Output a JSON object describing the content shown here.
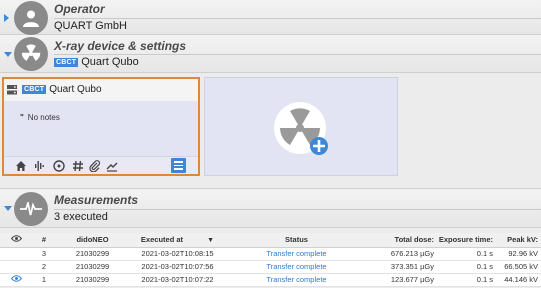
{
  "operator": {
    "title": "Operator",
    "name": "QUART GmbH"
  },
  "xray": {
    "title": "X-ray device & settings",
    "badge": "CBCT",
    "device": "Quart Qubo"
  },
  "device_card": {
    "badge": "CBCT",
    "name": "Quart Qubo",
    "notes_mark": "\"",
    "notes": "No notes",
    "tools": [
      "home-icon",
      "waveform-icon",
      "radiation-icon",
      "grid-icon",
      "attachment-icon",
      "chart-icon"
    ]
  },
  "measurements": {
    "title": "Measurements",
    "count": "3 executed"
  },
  "table": {
    "headers": {
      "num": "#",
      "device": "didoNEO",
      "executed": "Executed at",
      "status": "Status",
      "dose": "Total dose:",
      "exposure": "Exposure time:",
      "kv": "Peak kV:"
    },
    "rows": [
      {
        "num": "3",
        "device": "21030299",
        "executed": "2021-03-02T10:08:15",
        "status": "Transfer complete",
        "dose": "676.213 µGy",
        "exposure": "0.1 s",
        "kv": "92.96 kV"
      },
      {
        "num": "2",
        "device": "21030299",
        "executed": "2021-03-02T10:07:56",
        "status": "Transfer complete",
        "dose": "373.351 µGy",
        "exposure": "0.1 s",
        "kv": "66.505 kV"
      },
      {
        "num": "1",
        "device": "21030299",
        "executed": "2021-03-02T10:07:22",
        "status": "Transfer complete",
        "dose": "123.677 µGy",
        "exposure": "0.1 s",
        "kv": "44.146 kV"
      }
    ]
  },
  "colors": {
    "accent": "#3f87d6",
    "selection_border": "#d98a3a",
    "card_bg": "#e3e4f3"
  }
}
